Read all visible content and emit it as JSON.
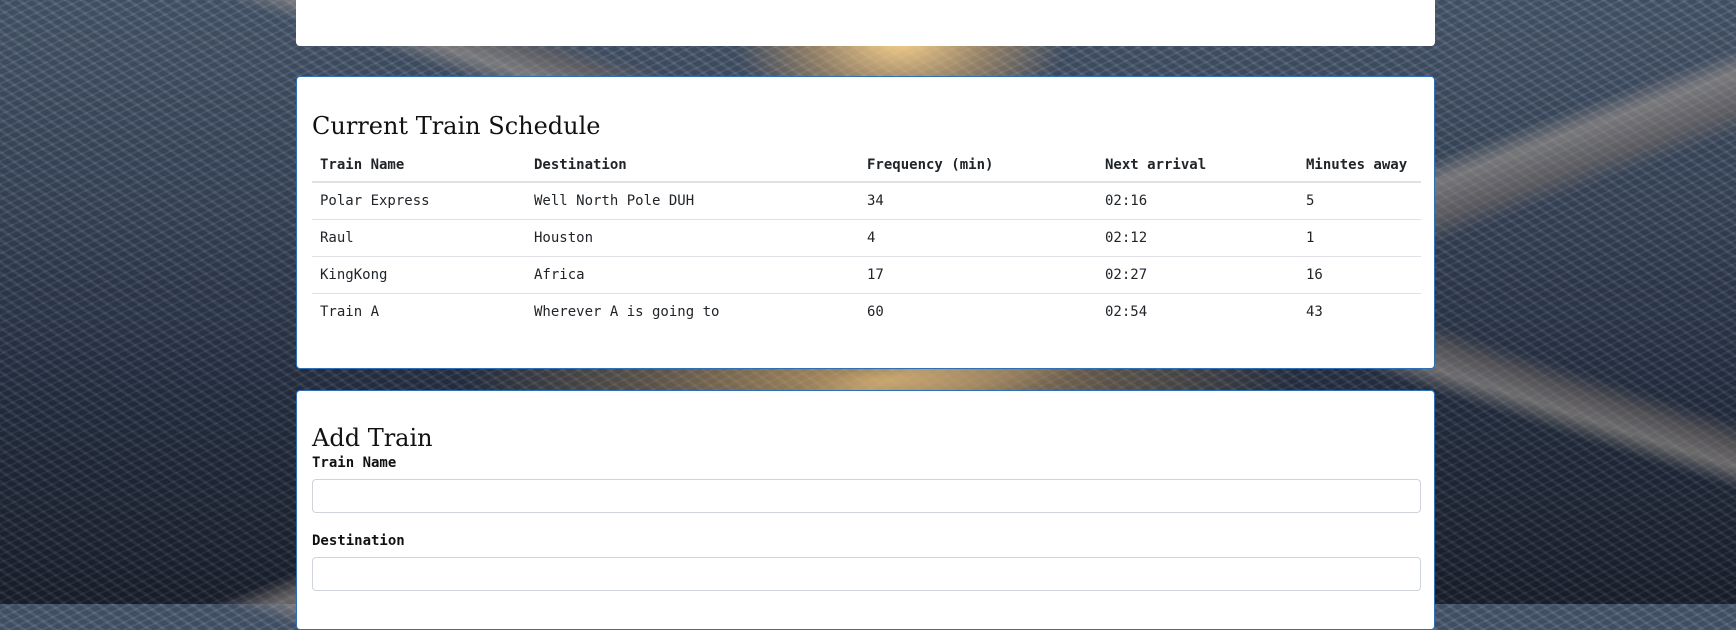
{
  "schedule": {
    "title": "Current Train Schedule",
    "headers": {
      "name": "Train Name",
      "destination": "Destination",
      "frequency": "Frequency (min)",
      "next_arrival": "Next arrival",
      "minutes_away": "Minutes away"
    },
    "rows": [
      {
        "name": "Polar Express",
        "destination": "Well North Pole DUH",
        "frequency": "34",
        "next_arrival": "02:16",
        "minutes_away": "5"
      },
      {
        "name": "Raul",
        "destination": "Houston",
        "frequency": "4",
        "next_arrival": "02:12",
        "minutes_away": "1"
      },
      {
        "name": "KingKong",
        "destination": "Africa",
        "frequency": "17",
        "next_arrival": "02:27",
        "minutes_away": "16"
      },
      {
        "name": "Train A",
        "destination": "Wherever A is going to",
        "frequency": "60",
        "next_arrival": "02:54",
        "minutes_away": "43"
      }
    ]
  },
  "add_train": {
    "title": "Add Train",
    "name_label": "Train Name",
    "name_value": "",
    "destination_label": "Destination",
    "destination_value": ""
  },
  "colors": {
    "panel_border": "#2f6fb5",
    "panel_bg": "#ffffff",
    "table_divider": "#dee2e6"
  }
}
